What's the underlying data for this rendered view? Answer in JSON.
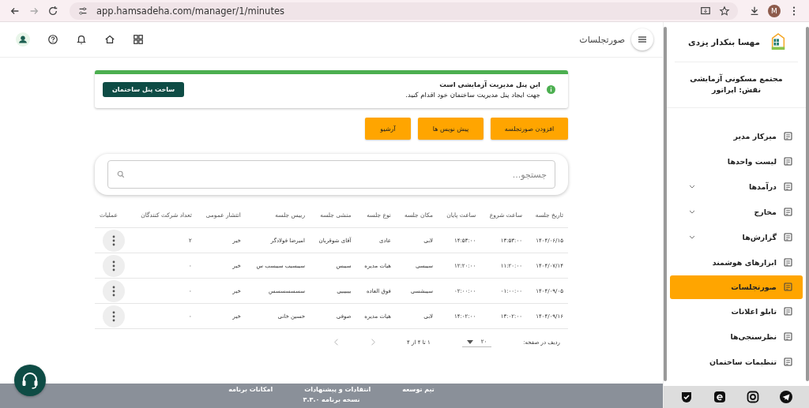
{
  "browser": {
    "url": "app.hamsadeha.com/manager/1/minutes",
    "profile_initial": "M"
  },
  "header": {
    "title": "صورتجلسات"
  },
  "sidebar": {
    "user_name": "مهسا بنکدار یزدی",
    "complex": "مجتمع مسکونی آزمایشی",
    "role": "نقش: اپراتور",
    "items": [
      {
        "label": "میزکار مدیر",
        "expandable": false,
        "selected": false
      },
      {
        "label": "لیست واحدها",
        "expandable": false,
        "selected": false
      },
      {
        "label": "درآمدها",
        "expandable": true,
        "selected": false
      },
      {
        "label": "مخارج",
        "expandable": true,
        "selected": false
      },
      {
        "label": "گزارش‌ها",
        "expandable": true,
        "selected": false
      },
      {
        "label": "ابزارهای هوشمند",
        "expandable": false,
        "selected": false
      },
      {
        "label": "صورتجلسات",
        "expandable": false,
        "selected": true
      },
      {
        "label": "تابلو اعلانات",
        "expandable": false,
        "selected": false
      },
      {
        "label": "نظرسنجی‌ها",
        "expandable": false,
        "selected": false
      },
      {
        "label": "تنظیمات ساختمان",
        "expandable": false,
        "selected": false
      }
    ]
  },
  "notice": {
    "title": "این پنل مدیریت آزمایشی است",
    "text": "جهت ایجاد پنل مدیریت ساختمان خود اقدام کنید.",
    "button": "ساخت پنل ساختمان"
  },
  "actions": [
    "افزودن صورتجلسه",
    "پیش نویس ها",
    "آرشیو"
  ],
  "search": {
    "placeholder": "جستجو..."
  },
  "table": {
    "columns": [
      "تاریخ جلسه",
      "ساعت شروع",
      "ساعت پایان",
      "مکان جلسه",
      "نوع جلسه",
      "منشی جلسه",
      "رییس جلسه",
      "انتشار عمومی",
      "تعداد شرکت کنندگان",
      "عملیات"
    ],
    "rows": [
      [
        "۱۴۰۴/۰۶/۱۵",
        "۱۳:۵۳:۰۰",
        "۱۴:۵۳:۰۰",
        "لابی",
        "عادی",
        "آقای شوقربان",
        "امیرضا فولادگر",
        "خیر",
        "۲"
      ],
      [
        "۱۴۰۴/۰۷/۱۴",
        "۱۱:۲۰:۰۰",
        "۱۲:۲۰:۰۰",
        "سیبسی",
        "هیات مدیره",
        "سیبس",
        "سیبسیب سیبسب س",
        "خیر",
        "۰"
      ],
      [
        "۱۴۰۴/۰۹/۰۵",
        "۰۱:۰۰:۰۰",
        "۰۲:۰۰:۰۰",
        "سیبشسی",
        "فوق العاده",
        "بیبیبیی",
        "سسسسسسس",
        "خیر",
        "۰"
      ],
      [
        "۱۴۰۴/۰۹/۱۶",
        "۱۳:۰۲:۰۰",
        "۱۴:۰۲:۰۰",
        "لابی",
        "هیات مدیره",
        "صوفی",
        "حسین خانی",
        "خیر",
        "۰"
      ]
    ]
  },
  "pagination": {
    "rows_label": "ردیف در صفحه:",
    "rows_value": "۲۰",
    "range": "۱ تا ۴ از ۴"
  },
  "footer": {
    "links": [
      "تیم توسعه",
      "انتقادات و پیشنهادات",
      "امکانات برنامه"
    ],
    "version": "نسخه برنامه ۳.۳.۰"
  }
}
